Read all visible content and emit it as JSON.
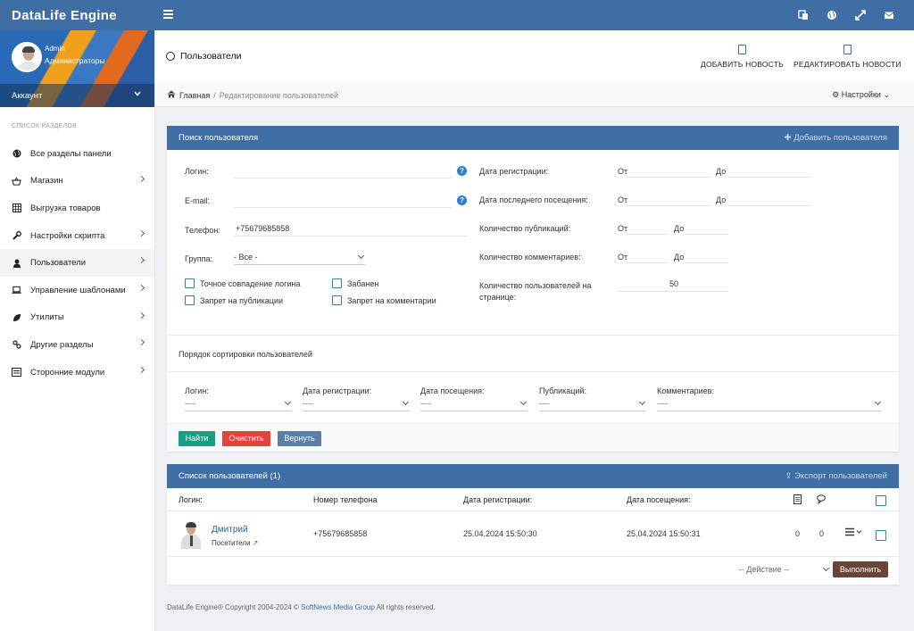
{
  "topbar": {
    "brand": "DataLife Engine"
  },
  "sidebar": {
    "profile": {
      "name": "Admin",
      "role": "Администраторы"
    },
    "account_label": "Аккаунт",
    "section_header": "СПИСОК РАЗДЕЛОВ",
    "items": [
      {
        "label": "Все разделы панели",
        "icon": "globe-icon"
      },
      {
        "label": "Магазин",
        "icon": "basket-icon"
      },
      {
        "label": "Выгрузка товаров",
        "icon": "table-icon"
      },
      {
        "label": "Настройки скрипта",
        "icon": "wrench-icon"
      },
      {
        "label": "Пользователи",
        "icon": "user-icon"
      },
      {
        "label": "Управление шаблонами",
        "icon": "laptop-icon"
      },
      {
        "label": "Утилиты",
        "icon": "leaf-icon"
      },
      {
        "label": "Другие разделы",
        "icon": "link-icon"
      },
      {
        "label": "Сторонние модули",
        "icon": "list-icon"
      }
    ]
  },
  "header": {
    "title": "Пользователи",
    "add_news": "ДОБАВИТЬ НОВОСТЬ",
    "edit_news": "РЕДАКТИРОВАТЬ НОВОСТИ"
  },
  "breadcrumb": {
    "home": "Главная",
    "current": "Редактирование пользователей",
    "settings": "Настройки"
  },
  "search": {
    "title": "Поиск пользователя",
    "add_user": "Добавить пользователя",
    "login_label": "Логин:",
    "email_label": "E-mail:",
    "phone_label": "Телефон:",
    "phone_value": "+75679685858",
    "group_label": "Группа:",
    "group_value": "- Все -",
    "cb_exact": "Точное совпадение логина",
    "cb_banned": "Забанен",
    "cb_nopub": "Запрет на публикации",
    "cb_nocomm": "Запрет на комментарии",
    "reg_date_label": "Дата регистрации:",
    "last_visit_label": "Дата последнего посещения:",
    "pubs_label": "Количество публикаций:",
    "comments_label": "Количество комментариев:",
    "per_page_label_1": "Количество пользователей на",
    "per_page_label_2": "странице:",
    "per_page_value": "50",
    "from": "От",
    "to": "До",
    "sort_title": "Порядок сортировки пользователей",
    "sort_cols": [
      "Логин:",
      "Дата регистрации:",
      "Дата посещения:",
      "Публикаций:",
      "Комментариев:"
    ],
    "sort_value": "----",
    "btn_find": "Найти",
    "btn_clear": "Очистить",
    "btn_back": "Вернуть"
  },
  "users": {
    "title": "Список пользователей (1)",
    "export": "Экспорт пользователей",
    "cols": {
      "login": "Логин:",
      "phone": "Номер телефона",
      "reg": "Дата регистрации:",
      "visit": "Дата посещения:"
    },
    "rows": [
      {
        "name": "Дмитрий",
        "group": "Посетители",
        "phone": "+75679685858",
        "reg": "25.04.2024 15:50:30",
        "visit": "25.04.2024 15:50:31",
        "news": "0",
        "comments": "0"
      }
    ],
    "action_placeholder": "-- Действие --",
    "execute": "Выполнить"
  },
  "footer": {
    "pre": "DataLife Engine® Copyright 2004-2024 ©",
    "link": "SoftNews Media Group",
    "post": "All rights reserved."
  },
  "colors": {
    "primary": "#3f6ea4",
    "find": "#1a9e83",
    "clear": "#e2433a",
    "back": "#5a7fa8",
    "execute": "#6b4338"
  }
}
